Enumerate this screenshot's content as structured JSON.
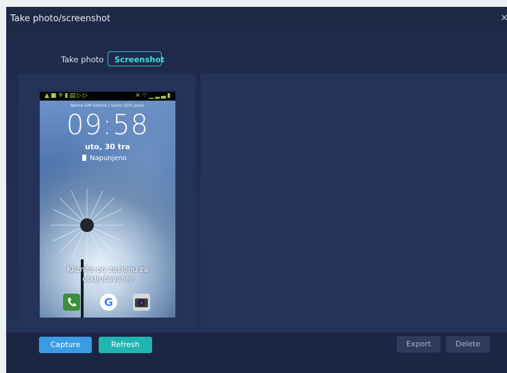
{
  "window": {
    "title": "Take photo/screenshot",
    "close_icon": "×"
  },
  "tabs": {
    "take_photo": "Take photo",
    "screenshot": "Screenshot",
    "active": "Screenshot"
  },
  "phone_preview": {
    "carrier_text": "Nema SIM kartice | Samo SOS poziv",
    "time": "09:58",
    "date": "uto, 30 tra",
    "battery_status": "Napunjeno",
    "unlock_text_line1": "Kliznite po zaslonu za",
    "unlock_text_line2": "otključavanje",
    "dock_apps": [
      "phone-app-icon",
      "google-app-icon",
      "camera-app-icon"
    ]
  },
  "buttons": {
    "capture": "Capture",
    "refresh": "Refresh",
    "export": "Export",
    "delete": "Delete"
  },
  "colors": {
    "accent_teal": "#29c7c9",
    "capture_blue": "#3a9de3",
    "refresh_teal": "#21b5b2",
    "background_navy": "#233259"
  }
}
